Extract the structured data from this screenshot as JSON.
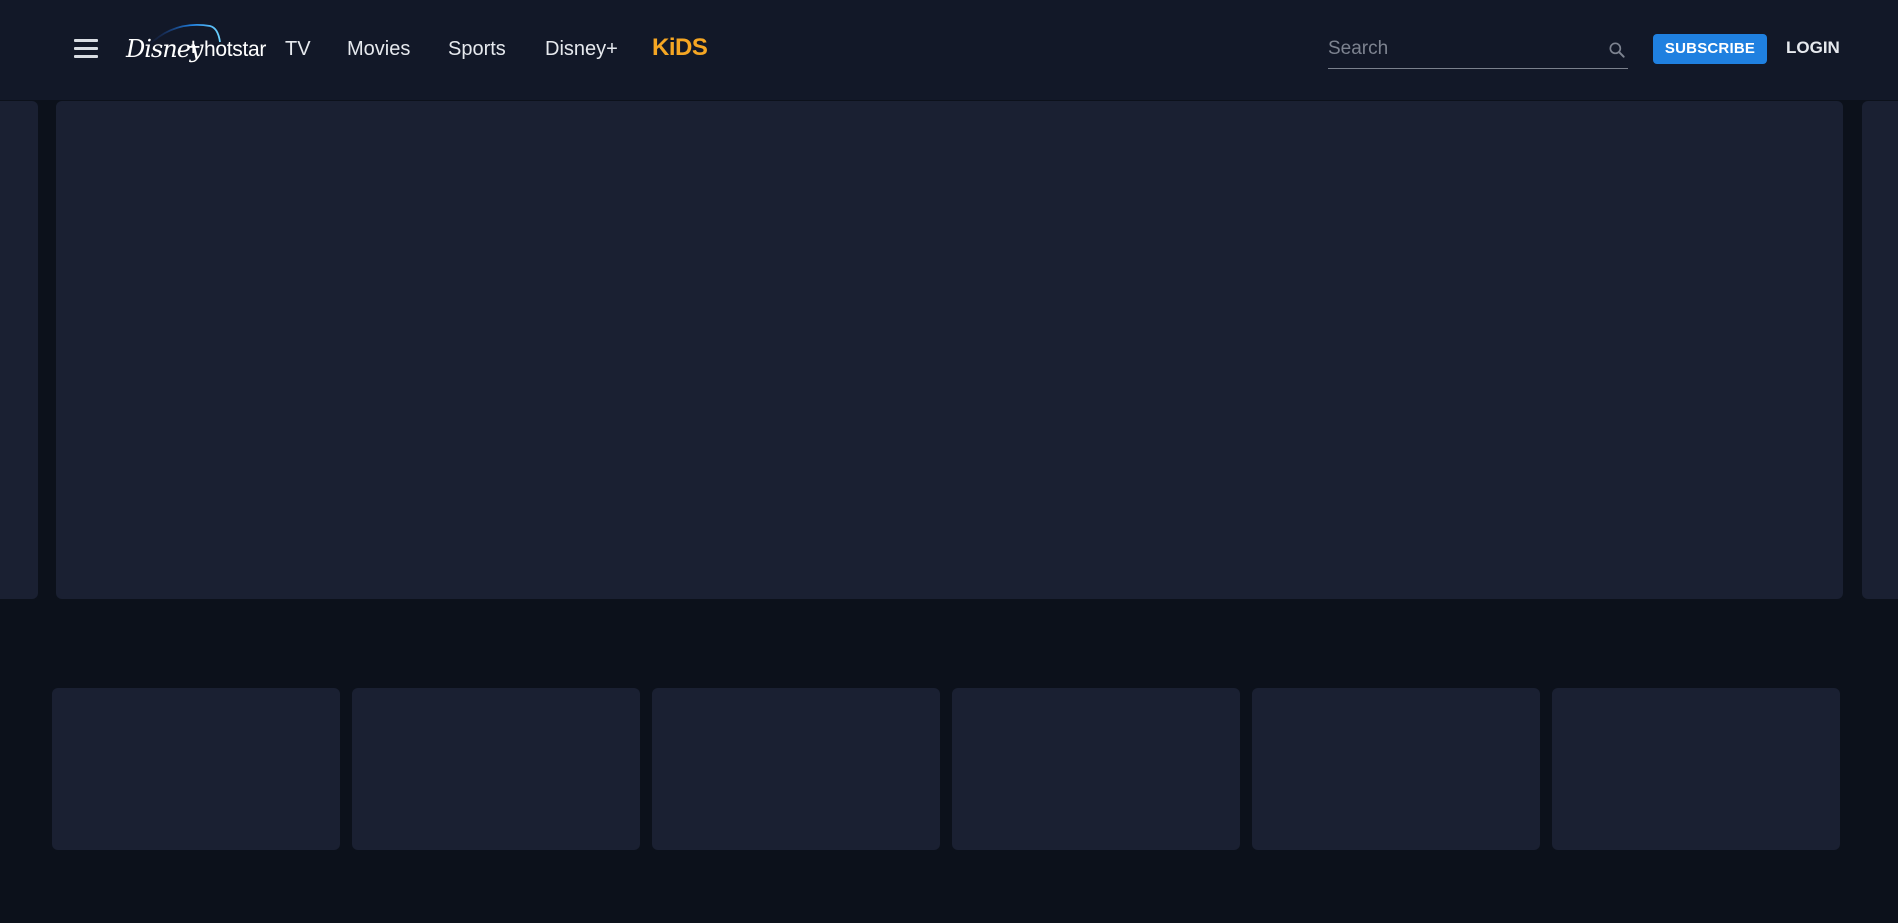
{
  "header": {
    "logo": {
      "brand": "Disney+ hotstar",
      "disney": "Disney",
      "plus": "+",
      "hotstar": "hotstar"
    },
    "nav": [
      {
        "label": "TV"
      },
      {
        "label": "Movies"
      },
      {
        "label": "Sports"
      },
      {
        "label": "Disney+"
      }
    ],
    "kids_label": "KiDS",
    "search": {
      "placeholder": "Search",
      "value": ""
    },
    "subscribe_label": "SUBSCRIBE",
    "login_label": "LOGIN"
  },
  "icons": {
    "menu": "hamburger-menu-icon",
    "search": "search-icon"
  },
  "colors": {
    "background": "#0c111b",
    "header": "#121828",
    "placeholder_card": "#1a2032",
    "accent_blue": "#1f80e0",
    "kids_orange": "#f5a623"
  }
}
